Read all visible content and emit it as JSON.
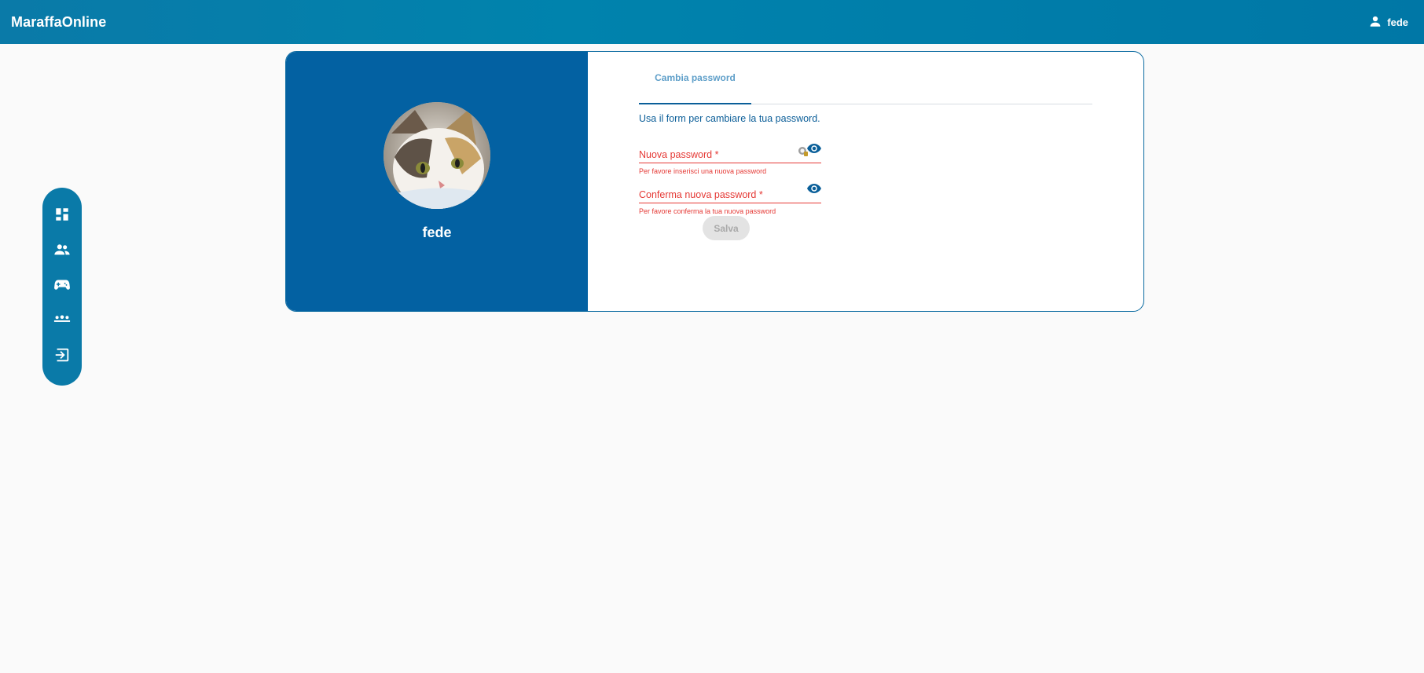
{
  "app": {
    "title": "MaraffaOnline"
  },
  "header": {
    "user_name": "fede",
    "user_icon": "person-icon"
  },
  "sidebar": {
    "items": [
      {
        "icon": "dashboard-icon"
      },
      {
        "icon": "people-icon"
      },
      {
        "icon": "gamepad-icon"
      },
      {
        "icon": "groups-icon"
      },
      {
        "icon": "login-icon"
      }
    ]
  },
  "profile": {
    "username": "fede",
    "avatar": "cat-photo"
  },
  "tabs": [
    {
      "label": "Cambia password",
      "active": true
    }
  ],
  "form": {
    "intro": "Usa il form per cambiare la tua password.",
    "new_password": {
      "placeholder": "Nuova password *",
      "value": "",
      "error": "Per favore inserisci una nuova password"
    },
    "confirm_password": {
      "placeholder": "Conferma nuova password *",
      "value": "",
      "error": "Per favore conferma la tua nuova password"
    },
    "save_label": "Salva"
  },
  "colors": {
    "topbar": "#0a7aa8",
    "card_left": "#0361a2",
    "accent": "#0a5f99",
    "error": "#e53935",
    "background": "#fafafa"
  }
}
